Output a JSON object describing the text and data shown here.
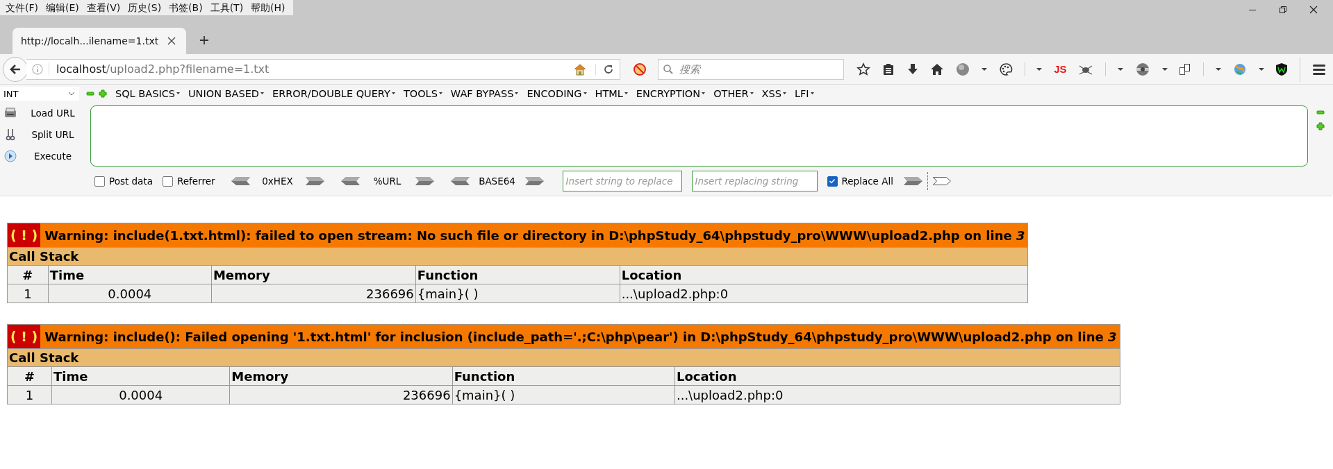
{
  "menu_bar": [
    "文件(F)",
    "编辑(E)",
    "查看(V)",
    "历史(S)",
    "书签(B)",
    "工具(T)",
    "帮助(H)"
  ],
  "tabs": [
    {
      "label": "http://localh...ilename=1.txt",
      "selected": true
    }
  ],
  "address": {
    "host": "localhost",
    "path": "/upload2.php?filename=1.txt"
  },
  "search": {
    "placeholder": "搜索"
  },
  "toolbar": {
    "js_label": "JS"
  },
  "hackbar": {
    "select": "INT",
    "menus": [
      "SQL BASICS",
      "UNION BASED",
      "ERROR/DOUBLE QUERY",
      "TOOLS",
      "WAF BYPASS",
      "ENCODING",
      "HTML",
      "ENCRYPTION",
      "OTHER",
      "XSS",
      "LFI"
    ],
    "actions": [
      {
        "kind": "load",
        "label": "Load URL"
      },
      {
        "kind": "split",
        "label": "Split URL"
      },
      {
        "kind": "execute",
        "label": "Execute"
      }
    ],
    "options": [
      {
        "label": "Post data",
        "checked": false
      },
      {
        "label": "Referrer",
        "checked": false
      }
    ],
    "encoders": [
      "0xHEX",
      "%URL",
      "BASE64"
    ],
    "replace_from": {
      "placeholder": "Insert string to replace"
    },
    "replace_to": {
      "placeholder": "Insert replacing string"
    },
    "replace_all": {
      "label": "Replace All",
      "checked": true
    }
  },
  "errors": [
    {
      "badge": "( ! )",
      "message": "Warning: include(1.txt.html): failed to open stream: No such file or directory in D:\\phpStudy_64\\phpstudy_pro\\WWW\\upload2.php on line *3*",
      "stack_title": "Call Stack",
      "columns": [
        "#",
        "Time",
        "Memory",
        "Function",
        "Location"
      ],
      "rows": [
        [
          "1",
          "0.0004",
          "236696",
          "{main}( )",
          "...\\upload2.php:0"
        ]
      ]
    },
    {
      "badge": "( ! )",
      "message": "Warning: include(): Failed opening '1.txt.html' for inclusion (include_path='.;C:\\php\\pear') in D:\\phpStudy_64\\phpstudy_pro\\WWW\\upload2.php on line *3*",
      "stack_title": "Call Stack",
      "columns": [
        "#",
        "Time",
        "Memory",
        "Function",
        "Location"
      ],
      "rows": [
        [
          "1",
          "0.0004",
          "236696",
          "{main}( )",
          "...\\upload2.php:0"
        ]
      ]
    }
  ]
}
